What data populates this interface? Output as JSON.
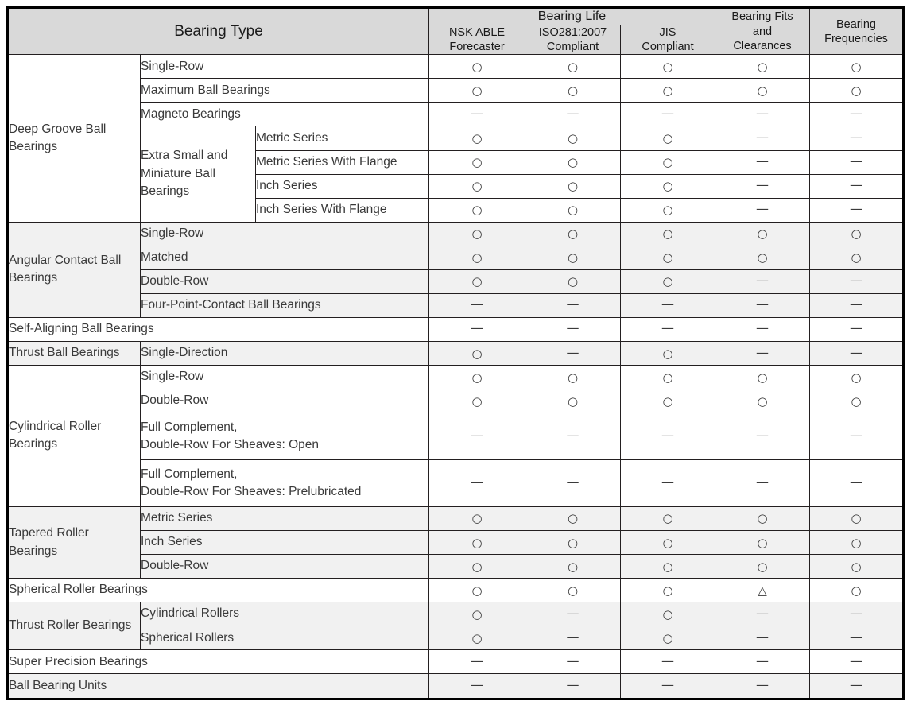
{
  "table": {
    "headers": {
      "bearing_type": "Bearing Type",
      "bearing_life": "Bearing Life",
      "nsk_able": "NSK ABLE\nForecaster",
      "iso281": "ISO281:2007\nCompliant",
      "jis": "JIS\nCompliant",
      "fits_clearances": "Bearing Fits\nand\nClearances",
      "frequencies": "Bearing\nFrequencies"
    },
    "symbols": {
      "circle": "○",
      "dash": "—",
      "triangle": "△"
    },
    "colors": {
      "header_bg": "#d9d9d9",
      "row_shade": "#f1f1f1",
      "row_plain": "#ffffff",
      "border": "#231f20",
      "text": "#3a3a3a"
    },
    "sections": [
      {
        "name": "Deep Groove Ball Bearings",
        "shaded": false,
        "rows": [
          {
            "sub": "Single-Row",
            "sub2": null,
            "marks": [
              "circle",
              "circle",
              "circle",
              "circle",
              "circle"
            ]
          },
          {
            "sub": "Maximum Ball Bearings",
            "sub2": null,
            "marks": [
              "circle",
              "circle",
              "circle",
              "circle",
              "circle"
            ]
          },
          {
            "sub": "Magneto Bearings",
            "sub2": null,
            "marks": [
              "dash",
              "dash",
              "dash",
              "dash",
              "dash"
            ]
          },
          {
            "sub": "Extra Small and\nMiniature Ball\nBearings",
            "sub2": "Metric Series",
            "marks": [
              "circle",
              "circle",
              "circle",
              "dash",
              "dash"
            ]
          },
          {
            "sub": null,
            "sub2": "Metric Series With Flange",
            "marks": [
              "circle",
              "circle",
              "circle",
              "dash",
              "dash"
            ]
          },
          {
            "sub": null,
            "sub2": "Inch Series",
            "marks": [
              "circle",
              "circle",
              "circle",
              "dash",
              "dash"
            ]
          },
          {
            "sub": null,
            "sub2": "Inch Series With Flange",
            "marks": [
              "circle",
              "circle",
              "circle",
              "dash",
              "dash"
            ]
          }
        ]
      },
      {
        "name": "Angular Contact Ball Bearings",
        "shaded": true,
        "rows": [
          {
            "sub": "Single-Row",
            "sub2": null,
            "marks": [
              "circle",
              "circle",
              "circle",
              "circle",
              "circle"
            ]
          },
          {
            "sub": "Matched",
            "sub2": null,
            "marks": [
              "circle",
              "circle",
              "circle",
              "circle",
              "circle"
            ]
          },
          {
            "sub": "Double-Row",
            "sub2": null,
            "marks": [
              "circle",
              "circle",
              "circle",
              "dash",
              "dash"
            ]
          },
          {
            "sub": "Four-Point-Contact Ball Bearings",
            "sub2": null,
            "marks": [
              "dash",
              "dash",
              "dash",
              "dash",
              "dash"
            ]
          }
        ]
      },
      {
        "name": "Self-Aligning Ball Bearings",
        "shaded": false,
        "full_span": true,
        "rows": [
          {
            "sub": null,
            "sub2": null,
            "marks": [
              "dash",
              "dash",
              "dash",
              "dash",
              "dash"
            ]
          }
        ]
      },
      {
        "name": "Thrust Ball Bearings",
        "shaded": true,
        "rows": [
          {
            "sub": "Single-Direction",
            "sub2": null,
            "marks": [
              "circle",
              "dash",
              "circle",
              "dash",
              "dash"
            ]
          }
        ]
      },
      {
        "name": "Cylindrical Roller Bearings",
        "shaded": false,
        "rows": [
          {
            "sub": "Single-Row",
            "sub2": null,
            "marks": [
              "circle",
              "circle",
              "circle",
              "circle",
              "circle"
            ]
          },
          {
            "sub": "Double-Row",
            "sub2": null,
            "marks": [
              "circle",
              "circle",
              "circle",
              "circle",
              "circle"
            ]
          },
          {
            "sub": "Full Complement,\nDouble-Row For Sheaves: Open",
            "sub2": null,
            "marks": [
              "dash",
              "dash",
              "dash",
              "dash",
              "dash"
            ]
          },
          {
            "sub": "Full Complement,\nDouble-Row For Sheaves: Prelubricated",
            "sub2": null,
            "marks": [
              "dash",
              "dash",
              "dash",
              "dash",
              "dash"
            ]
          }
        ]
      },
      {
        "name": "Tapered Roller Bearings",
        "shaded": true,
        "rows": [
          {
            "sub": "Metric Series",
            "sub2": null,
            "marks": [
              "circle",
              "circle",
              "circle",
              "circle",
              "circle"
            ]
          },
          {
            "sub": "Inch Series",
            "sub2": null,
            "marks": [
              "circle",
              "circle",
              "circle",
              "circle",
              "circle"
            ]
          },
          {
            "sub": "Double-Row",
            "sub2": null,
            "marks": [
              "circle",
              "circle",
              "circle",
              "circle",
              "circle"
            ]
          }
        ]
      },
      {
        "name": "Spherical Roller Bearings",
        "shaded": false,
        "full_span": true,
        "rows": [
          {
            "sub": null,
            "sub2": null,
            "marks": [
              "circle",
              "circle",
              "circle",
              "triangle",
              "circle"
            ]
          }
        ]
      },
      {
        "name": "Thrust Roller Bearings",
        "shaded": true,
        "rows": [
          {
            "sub": "Cylindrical Rollers",
            "sub2": null,
            "marks": [
              "circle",
              "dash",
              "circle",
              "dash",
              "dash"
            ]
          },
          {
            "sub": "Spherical Rollers",
            "sub2": null,
            "marks": [
              "circle",
              "dash",
              "circle",
              "dash",
              "dash"
            ]
          }
        ]
      },
      {
        "name": "Super Precision Bearings",
        "shaded": false,
        "full_span": true,
        "rows": [
          {
            "sub": null,
            "sub2": null,
            "marks": [
              "dash",
              "dash",
              "dash",
              "dash",
              "dash"
            ]
          }
        ]
      },
      {
        "name": "Ball Bearing Units",
        "shaded": true,
        "full_span": true,
        "rows": [
          {
            "sub": null,
            "sub2": null,
            "marks": [
              "dash",
              "dash",
              "dash",
              "dash",
              "dash"
            ]
          }
        ]
      }
    ]
  }
}
